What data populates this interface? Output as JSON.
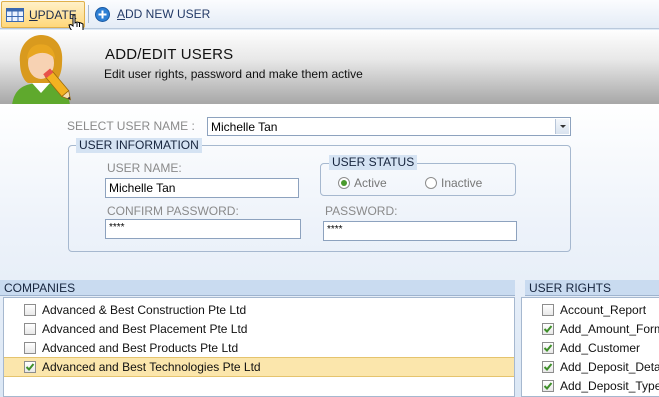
{
  "toolbar": {
    "update_label": "UPDATE",
    "add_user_label": "ADD NEW USER"
  },
  "header": {
    "title": "ADD/EDIT USERS",
    "subtitle": "Edit user rights, password and  make them active"
  },
  "select_user": {
    "label": "SELECT USER NAME :",
    "value": "Michelle Tan"
  },
  "user_info": {
    "title": "USER INFORMATION",
    "username_label": "USER NAME:",
    "username_value": "Michelle Tan",
    "confirm_password_label": "CONFIRM PASSWORD:",
    "confirm_password_value": "****",
    "password_label": "PASSWORD:",
    "password_value": "****"
  },
  "user_status": {
    "title": "USER STATUS",
    "options": [
      {
        "label": "Active",
        "selected": true
      },
      {
        "label": "Inactive",
        "selected": false
      }
    ]
  },
  "companies": {
    "title": "COMPANIES",
    "items": [
      {
        "label": "Advanced & Best Construction Pte Ltd",
        "checked": false
      },
      {
        "label": "Advanced and Best Placement Pte Ltd",
        "checked": false
      },
      {
        "label": "Advanced and Best Products Pte Ltd",
        "checked": false
      },
      {
        "label": "Advanced and Best Technologies Pte Ltd",
        "checked": true
      }
    ]
  },
  "user_rights": {
    "title": "USER RIGHTS",
    "items": [
      {
        "label": "Account_Report",
        "checked": false
      },
      {
        "label": "Add_Amount_Form",
        "checked": true
      },
      {
        "label": "Add_Customer",
        "checked": true
      },
      {
        "label": "Add_Deposit_Detail",
        "checked": true
      },
      {
        "label": "Add_Deposit_Type",
        "checked": true
      }
    ]
  },
  "colors": {
    "check": "#3f8f2a",
    "selected_row": "#fbe6ac",
    "section_bar": "#c9dbf0"
  }
}
